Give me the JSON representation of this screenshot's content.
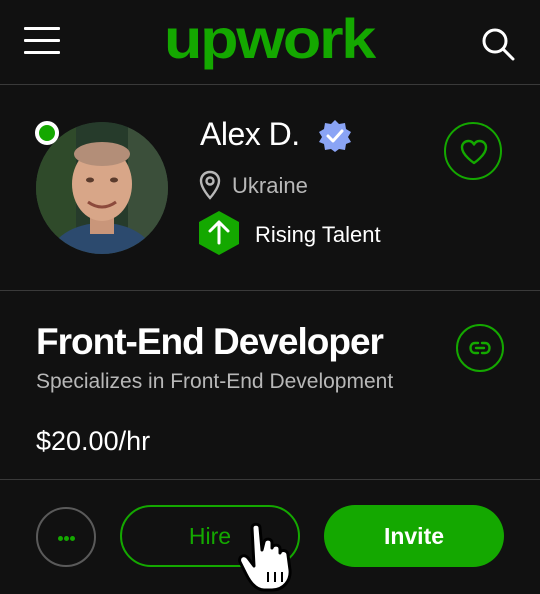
{
  "header": {
    "logo_text": "upwork",
    "menu_icon": "hamburger-menu-icon",
    "search_icon": "search-icon"
  },
  "profile": {
    "name": "Alex D.",
    "verified_icon": "verified-badge-icon",
    "location": "Ukraine",
    "badge_label": "Rising Talent",
    "status": "online",
    "favorite_icon": "heart-icon"
  },
  "details": {
    "title": "Front-End Developer",
    "subtitle": "Specializes in Front-End Development",
    "rate": "$20.00/hr",
    "share_icon": "link-icon"
  },
  "actions": {
    "more_icon": "more-dots-icon",
    "hire_label": "Hire",
    "invite_label": "Invite"
  },
  "colors": {
    "brand": "#14a800",
    "background": "#111111",
    "verified": "#8aa4f5",
    "muted_text": "#b8b8b8"
  }
}
